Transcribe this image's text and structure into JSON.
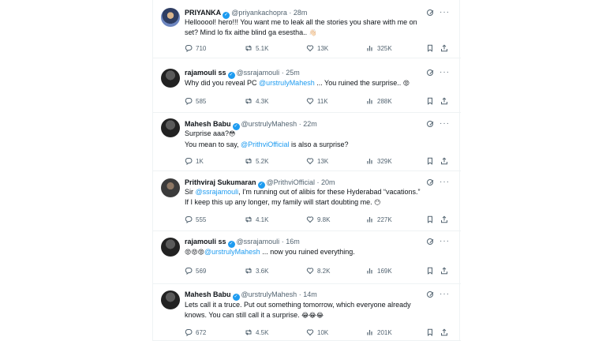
{
  "tweets": [
    {
      "name": "PRIYANKA",
      "handle": "@priyankachopra",
      "time": "28m",
      "lines": [
        [
          {
            "t": "Hellooool! hero!!! You want me to leak all the stories you share with me on"
          }
        ],
        [
          {
            "t": "set? Mind lo fix aithe blind ga esestha.. "
          },
          {
            "t": "👋🏻",
            "emoji": true
          }
        ]
      ],
      "stats": {
        "replies": "710",
        "reposts": "5.1K",
        "likes": "13K",
        "views": "325K"
      }
    },
    {
      "name": "rajamouli ss",
      "handle": "@ssrajamouli",
      "time": "25m",
      "lines": [
        [
          {
            "t": "Why did you reveal PC "
          },
          {
            "t": "@urstrulyMahesh",
            "m": true
          },
          {
            "t": " ... You ruined the surprise.. "
          },
          {
            "t": "😡",
            "emoji": true
          }
        ]
      ],
      "stats": {
        "replies": "585",
        "reposts": "4.3K",
        "likes": "11K",
        "views": "288K"
      }
    },
    {
      "name": "Mahesh Babu",
      "handle": "@urstrulyMahesh",
      "time": "22m",
      "lines": [
        [
          {
            "t": "Surprise aaa?"
          },
          {
            "t": "😳",
            "emoji": true
          }
        ],
        [
          {
            "t": "You mean to say, "
          },
          {
            "t": "@PrithviOfficial",
            "m": true
          },
          {
            "t": " is also a surprise?"
          }
        ]
      ],
      "stats": {
        "replies": "1K",
        "reposts": "5.2K",
        "likes": "13K",
        "views": "329K"
      }
    },
    {
      "name": "Prithviraj Sukumaran",
      "handle": "@PrithviOfficial",
      "time": "20m",
      "lines": [
        [
          {
            "t": "Sir "
          },
          {
            "t": "@ssrajamouli",
            "m": true
          },
          {
            "t": ", I'm running out of alibis for these Hyderabad “vacations.”"
          }
        ],
        [
          {
            "t": "If I keep this up any longer, my family will start doubting me. "
          },
          {
            "t": "😶",
            "emoji": true
          }
        ]
      ],
      "stats": {
        "replies": "555",
        "reposts": "4.1K",
        "likes": "9.8K",
        "views": "227K"
      }
    },
    {
      "name": "rajamouli ss",
      "handle": "@ssrajamouli",
      "time": "16m",
      "lines": [
        [
          {
            "t": "😡😡😡",
            "emoji": true
          },
          {
            "t": "@urstrulyMahesh",
            "m": true
          },
          {
            "t": " ... now you ruined everything."
          }
        ]
      ],
      "stats": {
        "replies": "569",
        "reposts": "3.6K",
        "likes": "8.2K",
        "views": "169K"
      }
    },
    {
      "name": "Mahesh Babu",
      "handle": "@urstrulyMahesh",
      "time": "14m",
      "lines": [
        [
          {
            "t": "Lets call it a truce. Put out something tomorrow, which everyone already"
          }
        ],
        [
          {
            "t": "knows.  You can still call it a surprise. "
          },
          {
            "t": "😂😂😂",
            "emoji": true
          }
        ]
      ],
      "stats": {
        "replies": "672",
        "reposts": "4.5K",
        "likes": "10K",
        "views": "201K"
      }
    }
  ],
  "icons": {
    "verified": "✓",
    "more": "···",
    "grok": "grok-icon",
    "reply": "reply-icon",
    "repost": "repost-icon",
    "like": "like-icon",
    "views": "views-icon",
    "bookmark": "bookmark-icon",
    "share": "share-icon"
  },
  "colors": {
    "accent": "#1d9bf0",
    "muted": "#536471",
    "text": "#0f1419",
    "divider": "#eff3f4"
  }
}
